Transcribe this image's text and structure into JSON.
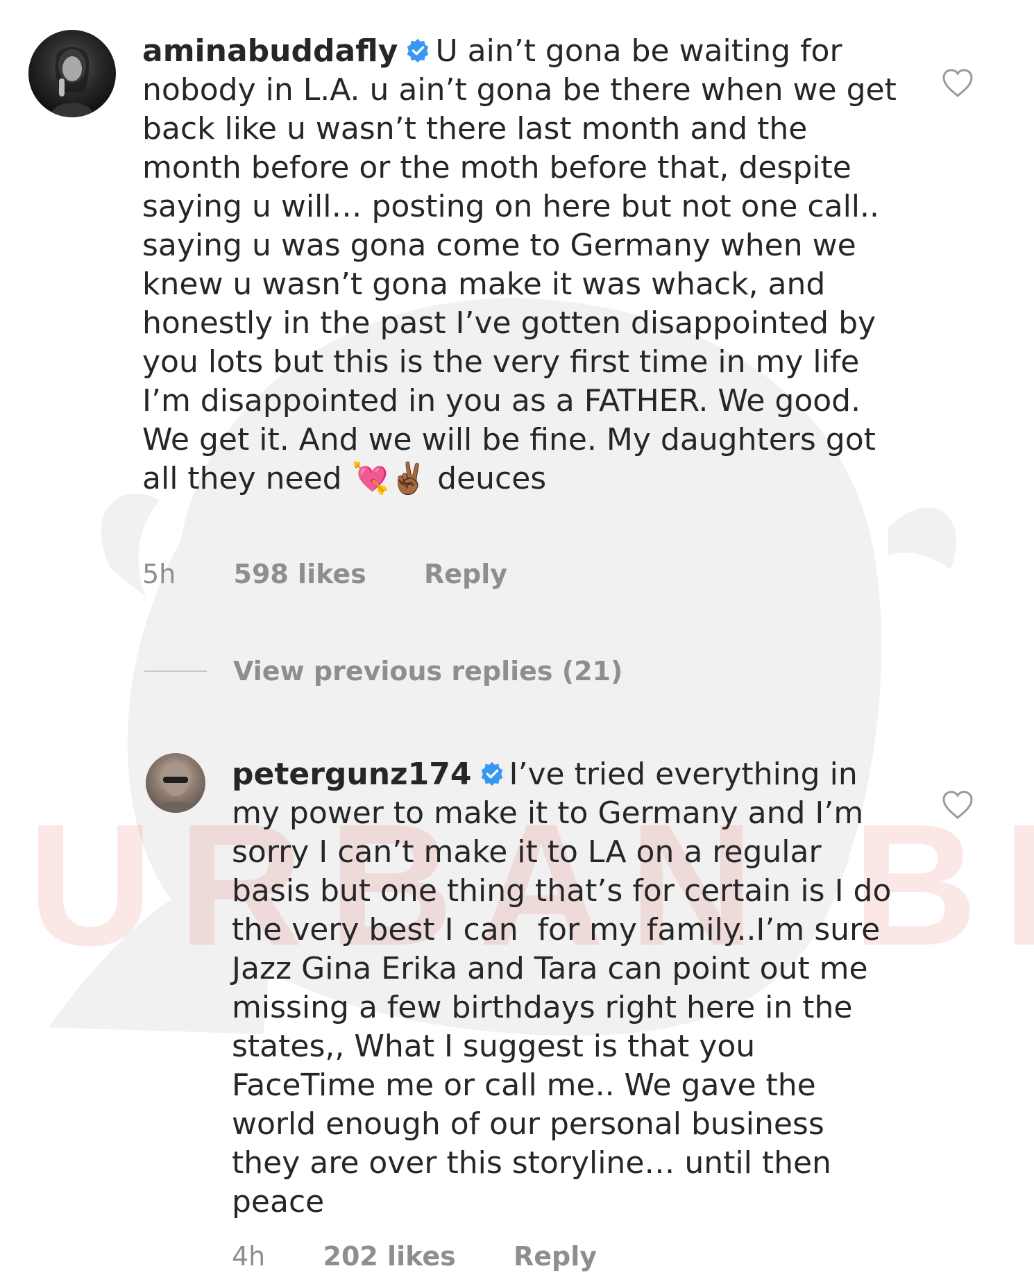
{
  "watermark": {
    "text": "URBAN BELLE"
  },
  "comments": [
    {
      "username": "aminabuddafly",
      "verified": true,
      "body": "U ain’t gona be waiting for nobody in L.A. u ain’t gona be there when we get back like u wasn’t there last month and the month before or the moth before that, despite saying u will… posting on here but not one call.. saying u was gona come to Germany when we knew u wasn’t gona make it was whack, and honestly in the past I’ve gotten disappointed by you lots but this is the very first time in my life I’m disappointed in you as a FATHER. We good. We get it. And we will be fine. My daughters got all they need 💘✌🏾 deuces",
      "age": "5h",
      "likes": "598 likes",
      "reply_label": "Reply",
      "avatar_icon": "avatar-photo",
      "like_icon": "heart-outline-icon"
    },
    {
      "username": "petergunz174",
      "verified": true,
      "body": "I’ve tried everything in my power to make it to Germany and I’m sorry I can’t make it to LA on a regular basis but one thing that’s for certain is I do the very best I can  for my family..I’m sure Jazz Gina Erika and Tara can point out me missing a few birthdays right here in the states,, What I suggest is that you FaceTime me or call me.. We gave the world enough of our personal business they are over this storyline… until then peace",
      "age": "4h",
      "likes": "202 likes",
      "reply_label": "Reply",
      "avatar_icon": "avatar-photo",
      "like_icon": "heart-outline-icon"
    }
  ],
  "view_replies": {
    "label": "View previous replies (21)"
  },
  "colors": {
    "text": "#262626",
    "muted": "#8e8e8e",
    "verified_blue": "#3897f0",
    "watermark": "#eb4646"
  }
}
